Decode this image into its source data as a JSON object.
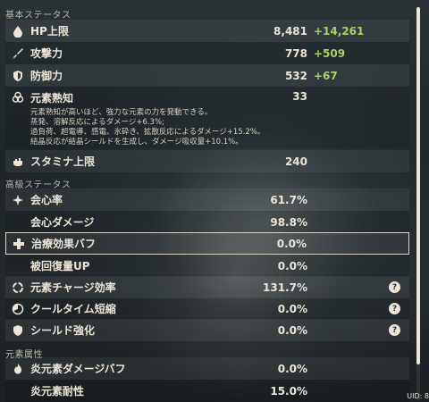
{
  "sections": {
    "basic": "基本ステータス",
    "advanced": "高級ステータス",
    "elemental": "元素属性"
  },
  "stats": {
    "hp": {
      "label": "HP上限",
      "value": "8,481",
      "bonus": "+14,261"
    },
    "atk": {
      "label": "攻撃力",
      "value": "778",
      "bonus": "+509"
    },
    "def": {
      "label": "防御力",
      "value": "532",
      "bonus": "+67"
    },
    "em": {
      "label": "元素熟知",
      "value": "33"
    },
    "em_desc": [
      "元素熟知が高いほど、強力な元素の力を発動できる。",
      "蒸発、溶解反応によるダメージ+6.3%;",
      "過負荷、超電導、感電、氷砕き、拡散反応によるダメージ+15.2%。",
      "結晶反応が結晶シールドを生成し、ダメージ吸収量+10.1%。"
    ],
    "stamina": {
      "label": "スタミナ上限",
      "value": "240"
    },
    "crit_rate": {
      "label": "会心率",
      "value": "61.7%"
    },
    "crit_dmg": {
      "label": "会心ダメージ",
      "value": "98.8%"
    },
    "heal": {
      "label": "治療効果バフ",
      "value": "0.0%"
    },
    "incoming_heal": {
      "label": "被回復量UP",
      "value": "0.0%"
    },
    "er": {
      "label": "元素チャージ効率",
      "value": "131.7%"
    },
    "cd": {
      "label": "クールタイム短縮",
      "value": "0.0%"
    },
    "shield": {
      "label": "シールド強化",
      "value": "0.0%"
    },
    "pyro_dmg": {
      "label": "炎元素ダメージバフ",
      "value": "0.0%"
    },
    "pyro_res": {
      "label": "炎元素耐性",
      "value": "15.0%"
    }
  },
  "help_glyph": "?",
  "uid": "UID: 8",
  "colors": {
    "bonus": "#a6d36a",
    "text": "#ece5d8"
  }
}
